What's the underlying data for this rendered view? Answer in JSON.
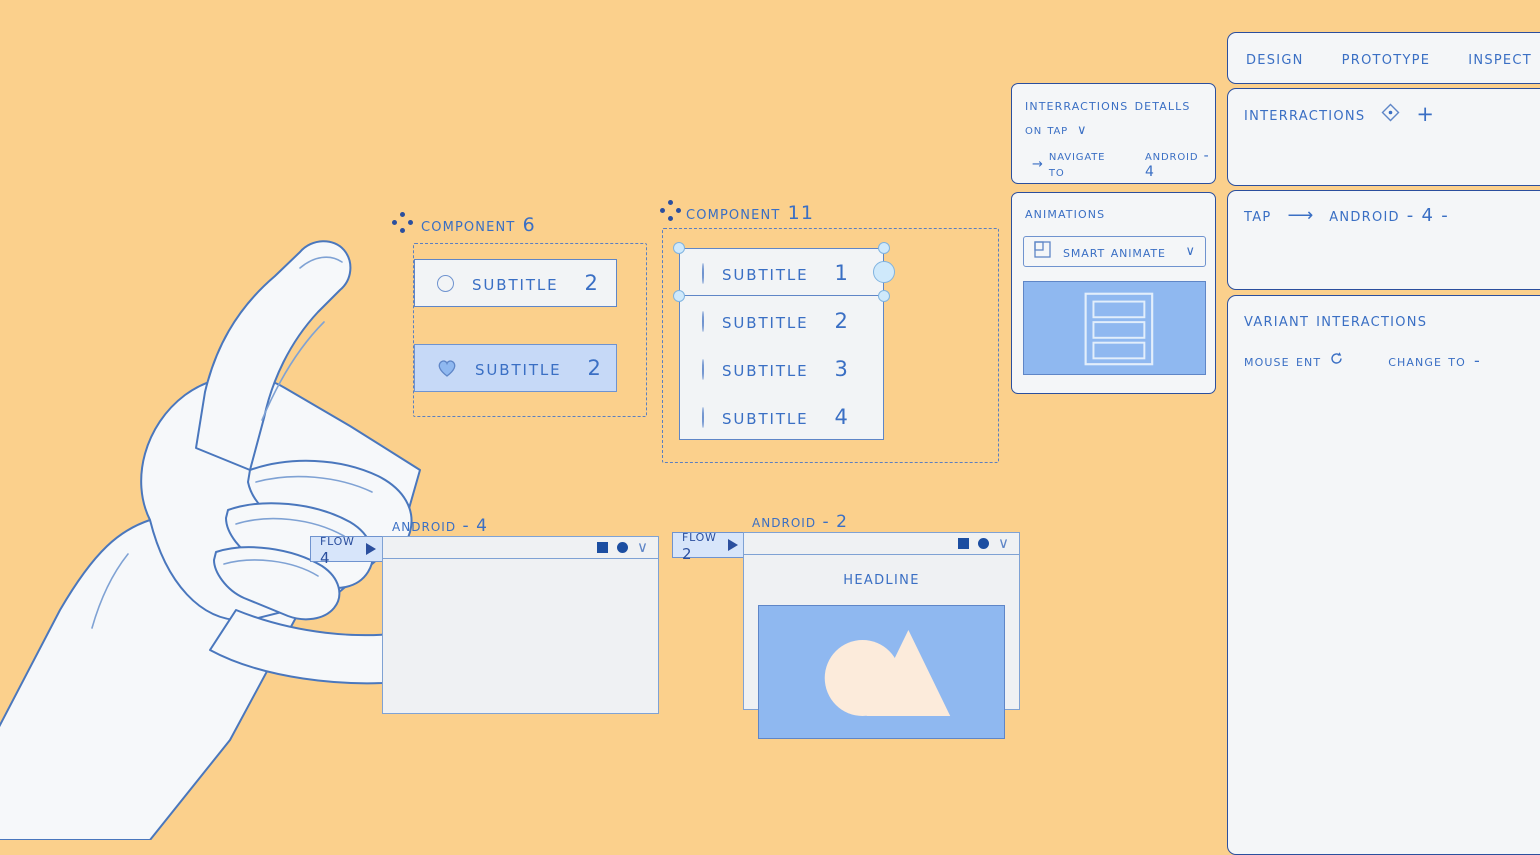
{
  "theme": {
    "background": "#FBD08C",
    "ink": "#2b4f9e",
    "accent": "#3a6fc4",
    "panel": "#F4F6F8",
    "selected_fill": "#C6D9F7",
    "hero_blue": "#8FB8F0",
    "handle_fill": "#CFE9FB"
  },
  "canvas": {
    "component_6": {
      "name": "Component 6",
      "icon": "component-dots-icon",
      "rows": [
        {
          "icon": "circle-icon",
          "label": "Subtitle",
          "number": "2",
          "selected": false
        },
        {
          "icon": "heart-icon",
          "label": "Subtitle",
          "number": "2",
          "selected": true
        }
      ]
    },
    "component_11": {
      "name": "Component 11",
      "icon": "component-dots-icon",
      "rows": [
        {
          "icon": "circle-icon",
          "label": "Subtitle",
          "number": "1",
          "selected": true
        },
        {
          "icon": "circle-icon",
          "label": "Subtitle",
          "number": "2",
          "selected": false
        },
        {
          "icon": "circle-icon",
          "label": "Subtitle",
          "number": "3",
          "selected": false
        },
        {
          "icon": "circle-icon",
          "label": "Subtitle",
          "number": "4",
          "selected": false
        }
      ]
    },
    "frames": [
      {
        "title": "Android - 4",
        "flow_tag": "Flow 4",
        "window_icons": [
          "square-icon",
          "circle-filled-icon",
          "chevron-down-icon"
        ],
        "content": "empty"
      },
      {
        "title": "Android - 2",
        "flow_tag": "Flow 2",
        "window_icons": [
          "square-icon",
          "circle-filled-icon",
          "chevron-down-icon"
        ],
        "headline": "Headline",
        "content": "hero-shapes"
      }
    ]
  },
  "popovers": {
    "interactions_details": {
      "title": "Interractions detalls",
      "trigger": "on tap",
      "trigger_chevron": "chevron-down-icon",
      "action_arrow": "arrow-right-icon",
      "action": "Navigate to",
      "destination": "Android - 4"
    },
    "animations": {
      "title": "Animations",
      "select_icon": "smart-animate-icon",
      "select_value": "Smart animate",
      "select_chevron": "chevron-down-icon",
      "preview": "blue-list-preview"
    }
  },
  "sidebar": {
    "tabs": [
      {
        "label": "Design",
        "active": false
      },
      {
        "label": "Prototype",
        "active": true
      },
      {
        "label": "Inspect",
        "active": false
      }
    ],
    "interactions_card": {
      "title": "Interractions",
      "target_icon": "diamond-target-icon",
      "add_icon": "plus-icon"
    },
    "tap_card": {
      "trigger": "Tap",
      "arrow_icon": "arrow-right-icon",
      "destination": "Android - 4 -"
    },
    "variant_card": {
      "title": "Variant interactions",
      "trigger": "mouse ent",
      "trigger_icon": "refresh-icon",
      "action": "change to",
      "value": "-"
    }
  }
}
